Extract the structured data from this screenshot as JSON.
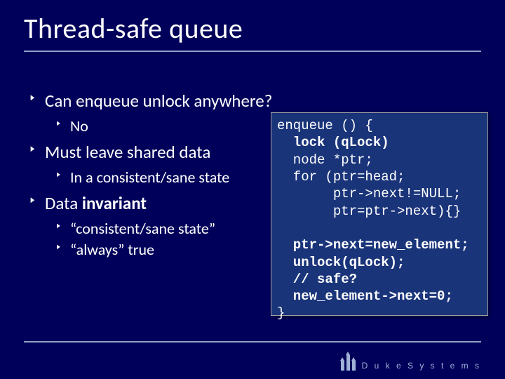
{
  "title": "Thread-safe queue",
  "bullets": {
    "b1": "Can enqueue unlock anywhere?",
    "b1_1": "No",
    "b2": "Must leave shared data",
    "b2_1": "In a consistent/sane state",
    "b3_pre": "Data ",
    "b3_bold": "invariant",
    "b3_1": "“consistent/sane state”",
    "b3_2": "“always” true"
  },
  "code": {
    "l1": "enqueue () {",
    "l2": "  lock (qLock)",
    "l3": "  node *ptr;",
    "l4": "  for (ptr=head;",
    "l5": "       ptr->next!=NULL;",
    "l6": "       ptr=ptr->next){}",
    "l7": "",
    "l8": "  ptr->next=new_element;",
    "l9": "  unlock(qLock);",
    "l10": "  // safe?",
    "l11": "  new_element->next=0;",
    "l12": "}"
  },
  "footer": {
    "brand": "D u k e   S y s t e m s"
  }
}
